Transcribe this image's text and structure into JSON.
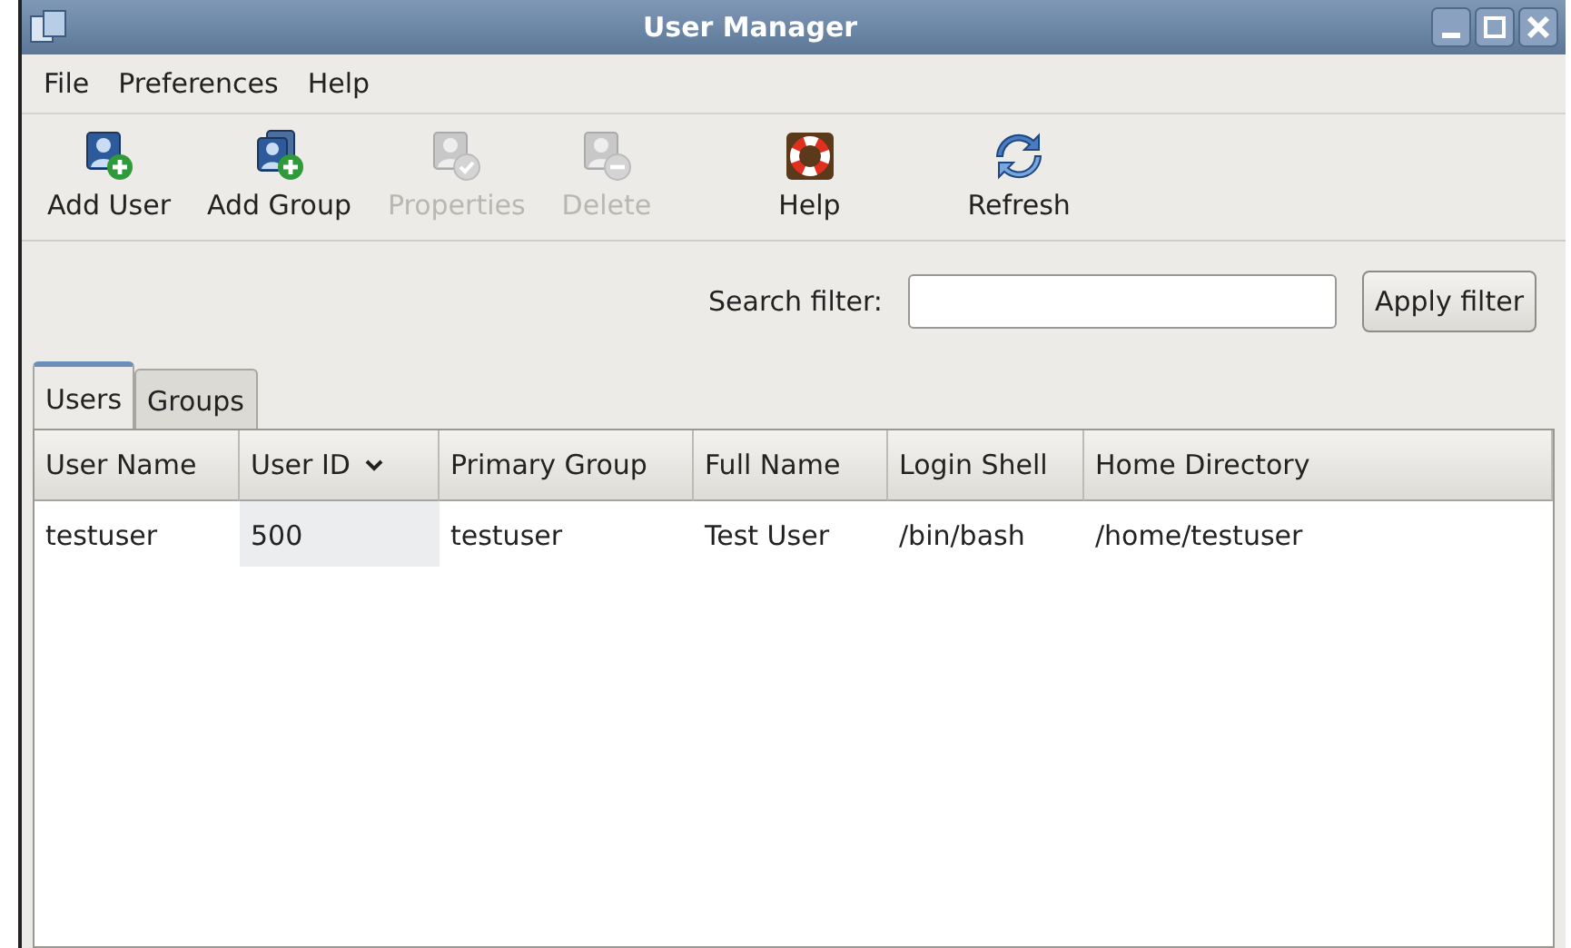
{
  "window": {
    "title": "User Manager"
  },
  "menu": [
    "File",
    "Preferences",
    "Help"
  ],
  "toolbar": [
    {
      "label": "Add User",
      "kind": "add-user",
      "disabled": false
    },
    {
      "label": "Add Group",
      "kind": "add-group",
      "disabled": false
    },
    {
      "label": "Properties",
      "kind": "properties",
      "disabled": true
    },
    {
      "label": "Delete",
      "kind": "delete",
      "disabled": true
    },
    {
      "label": "Help",
      "kind": "help",
      "disabled": false
    },
    {
      "label": "Refresh",
      "kind": "refresh",
      "disabled": false
    }
  ],
  "search": {
    "label": "Search filter:",
    "button": "Apply filter"
  },
  "tabs": [
    {
      "label": "Users",
      "selected": true
    },
    {
      "label": "Groups",
      "selected": false
    }
  ],
  "table": {
    "columns": [
      {
        "label": "User Name",
        "sorted": false
      },
      {
        "label": "User ID",
        "sorted": true
      },
      {
        "label": "Primary Group",
        "sorted": false
      },
      {
        "label": "Full Name",
        "sorted": false
      },
      {
        "label": "Login Shell",
        "sorted": false
      },
      {
        "label": "Home Directory",
        "sorted": false
      }
    ],
    "rows": [
      [
        "testuser",
        "500",
        "testuser",
        "Test User",
        "/bin/bash",
        "/home/testuser"
      ]
    ]
  }
}
